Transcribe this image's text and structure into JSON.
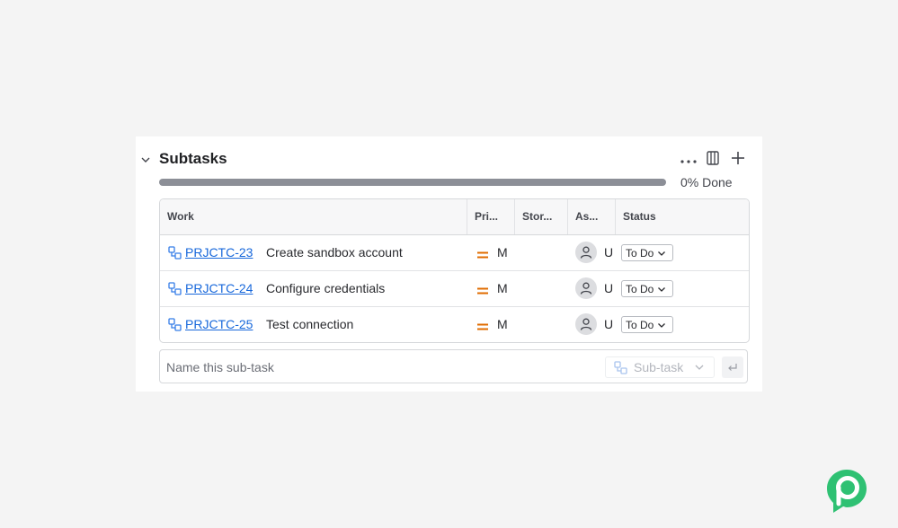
{
  "panel": {
    "title": "Subtasks",
    "progress": {
      "fraction": 0.0,
      "label": "0% Done"
    }
  },
  "icons": {
    "collapse": "chevron-down-icon",
    "more": "more-horizontal-icon",
    "columns": "columns-icon",
    "add": "plus-icon",
    "subtask": "subtask-icon",
    "priority": "priority-medium-icon",
    "assignee": "person-icon",
    "dropdown": "chevron-down-icon",
    "submit": "enter-icon",
    "logo": "brand-logo"
  },
  "colors": {
    "link": "#1868db",
    "priority_medium": "#e06c00",
    "progress_fill": "#8c8f97",
    "logo_green": "#2fc173"
  },
  "table": {
    "columns": [
      "Work",
      "Pri...",
      "Stor...",
      "As...",
      "Status"
    ],
    "rows": [
      {
        "key": "PRJCTC-23",
        "summary": "Create sandbox account",
        "priority": "M",
        "story_points": "",
        "assignee": "U",
        "status": "To Do"
      },
      {
        "key": "PRJCTC-24",
        "summary": "Configure credentials",
        "priority": "M",
        "story_points": "",
        "assignee": "U",
        "status": "To Do"
      },
      {
        "key": "PRJCTC-25",
        "summary": "Test connection",
        "priority": "M",
        "story_points": "",
        "assignee": "U",
        "status": "To Do"
      }
    ]
  },
  "create": {
    "placeholder": "Name this sub-task",
    "type_label": "Sub-task"
  }
}
